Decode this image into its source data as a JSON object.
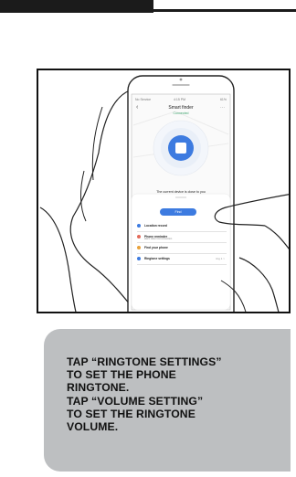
{
  "phone_app": {
    "status_left": "No Service",
    "status_time": "4:15 PM",
    "status_right": "61%",
    "back_icon": "chevron-left-icon",
    "title": "Smart finder",
    "subtitle": "Connected",
    "more_icon": "more-icon",
    "device_message": "The current device is close to you",
    "find_button": "Find",
    "menu": [
      {
        "label": "Location record",
        "sub": "",
        "value": "",
        "icon": "location-icon",
        "color": "#3d7be0"
      },
      {
        "label": "Phone reminder",
        "sub": "alarm when lost connection",
        "value": "",
        "icon": "bell-icon",
        "color": "#e36b5b"
      },
      {
        "label": "Find your phone",
        "sub": "",
        "value": "",
        "icon": "phone-icon",
        "color": "#e9a23b"
      },
      {
        "label": "Ringtone settings",
        "sub": "",
        "value": "ring 1 >",
        "icon": "music-icon",
        "color": "#3d7be0"
      }
    ]
  },
  "instruction": {
    "text": "TAP “RINGTONE SETTINGS”\nTO SET THE PHONE\nRINGTONE.\nTAP “VOLUME SETTING”\nTO SET THE RINGTONE\nVOLUME."
  }
}
